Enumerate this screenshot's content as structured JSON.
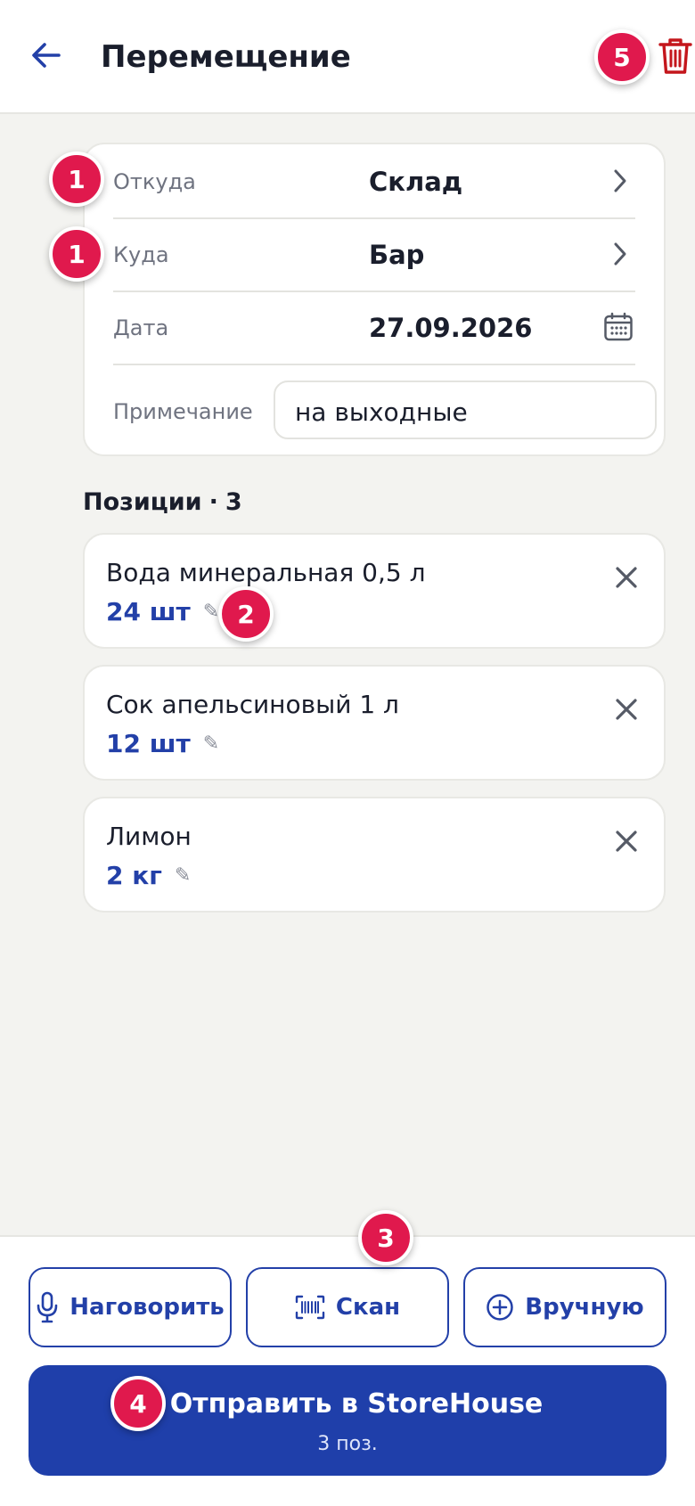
{
  "header": {
    "title": "Перемещение"
  },
  "form": {
    "from": {
      "label": "Откуда",
      "value": "Склад"
    },
    "to": {
      "label": "Куда",
      "value": "Бар"
    },
    "date": {
      "label": "Дата",
      "value": "27.09.2026"
    },
    "note": {
      "label": "Примечание",
      "value": "на выходные"
    }
  },
  "positions": {
    "title": "Позиции",
    "separator": "·",
    "count": "3",
    "items": [
      {
        "name": "Вода минеральная 0,5 л",
        "qty": "24 шт"
      },
      {
        "name": "Сок апельсиновый 1 л",
        "qty": "12 шт"
      },
      {
        "name": "Лимон",
        "qty": "2 кг"
      }
    ]
  },
  "actions": {
    "voice_label": "Наговорить",
    "scan_label": "Скан",
    "manual_label": "Вручную"
  },
  "send": {
    "label": "Отправить в StoreHouse",
    "sub": "3 поз."
  },
  "badges": {
    "b1": "1",
    "b2": "2",
    "b3": "3",
    "b4": "4",
    "b5": "5"
  },
  "icons": {
    "back": "arrow-left-icon",
    "trash": "trash-icon",
    "chevron": "chevron-right-icon",
    "calendar": "calendar-icon",
    "close": "close-icon",
    "edit": "pencil-icon",
    "mic": "microphone-icon",
    "barcode": "barcode-icon",
    "plus": "plus-circle-icon"
  },
  "colors": {
    "accent": "#1F3FAA",
    "badge": "#E0194D",
    "danger": "#C4161C",
    "background": "#F3F3F0"
  }
}
